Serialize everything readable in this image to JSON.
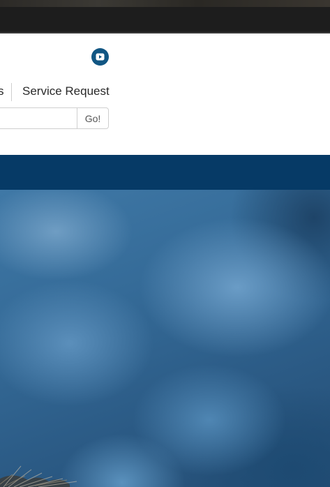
{
  "header": {
    "social": {
      "youtube_icon": "youtube-icon"
    },
    "nav": {
      "partial_item": "s",
      "service_request": "Service Request"
    },
    "search": {
      "value": "",
      "placeholder": "",
      "button_label": "Go!"
    }
  },
  "colors": {
    "brand_blue": "#063a66",
    "icon_blue": "#115683",
    "dark_bar": "#1d1d1d"
  },
  "hero": {
    "image": "blurred-blue-bokeh-photo"
  }
}
